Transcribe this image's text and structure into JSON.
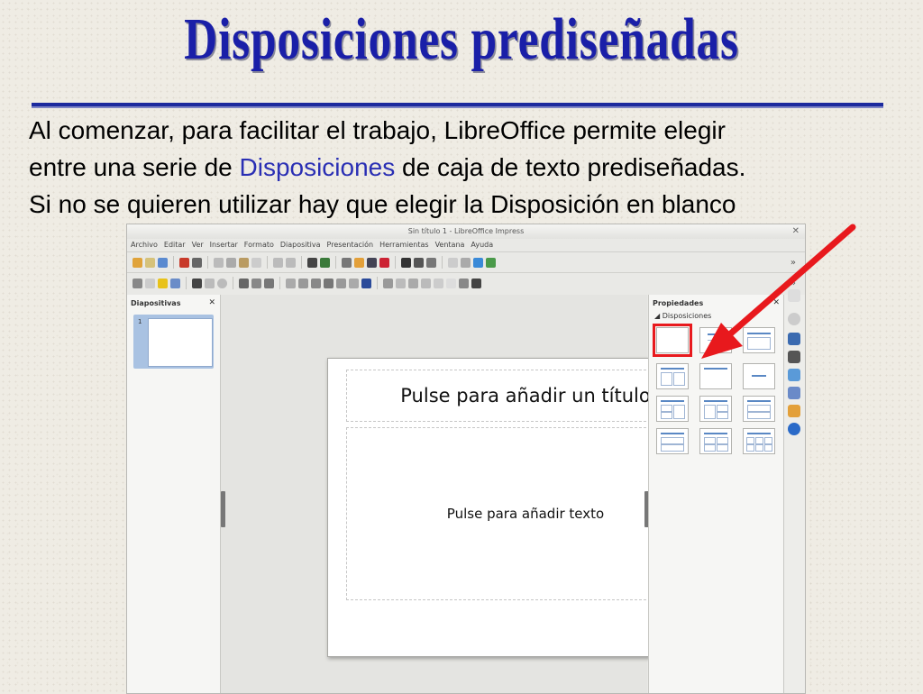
{
  "slide": {
    "title": "Disposiciones prediseñadas",
    "line1": "Al comenzar, para facilitar el trabajo, LibreOffice permite elegir",
    "line2_a": "entre una serie de ",
    "line2_hl": "Disposiciones",
    "line2_b": " de caja de texto prediseñadas.",
    "line3": "Si no se quieren utilizar hay que elegir la Disposición en blanco",
    "accent_color": "#1a1fa8",
    "arrow_color": "#e8191d"
  },
  "window": {
    "title": "Sin título 1 - LibreOffice Impress",
    "close_glyph": "✕",
    "menu": [
      "Archivo",
      "Editar",
      "Ver",
      "Insertar",
      "Formato",
      "Diapositiva",
      "Presentación",
      "Herramientas",
      "Ventana",
      "Ayuda"
    ],
    "toolbar_more": "»",
    "slides_panel": {
      "title": "Diapositivas",
      "close": "✕",
      "slide_number": "1"
    },
    "canvas": {
      "title_placeholder": "Pulse para añadir un título",
      "body_placeholder": "Pulse para añadir texto"
    },
    "properties": {
      "title": "Propiedades",
      "close": "✕",
      "section": "◢ Disposiciones"
    }
  }
}
